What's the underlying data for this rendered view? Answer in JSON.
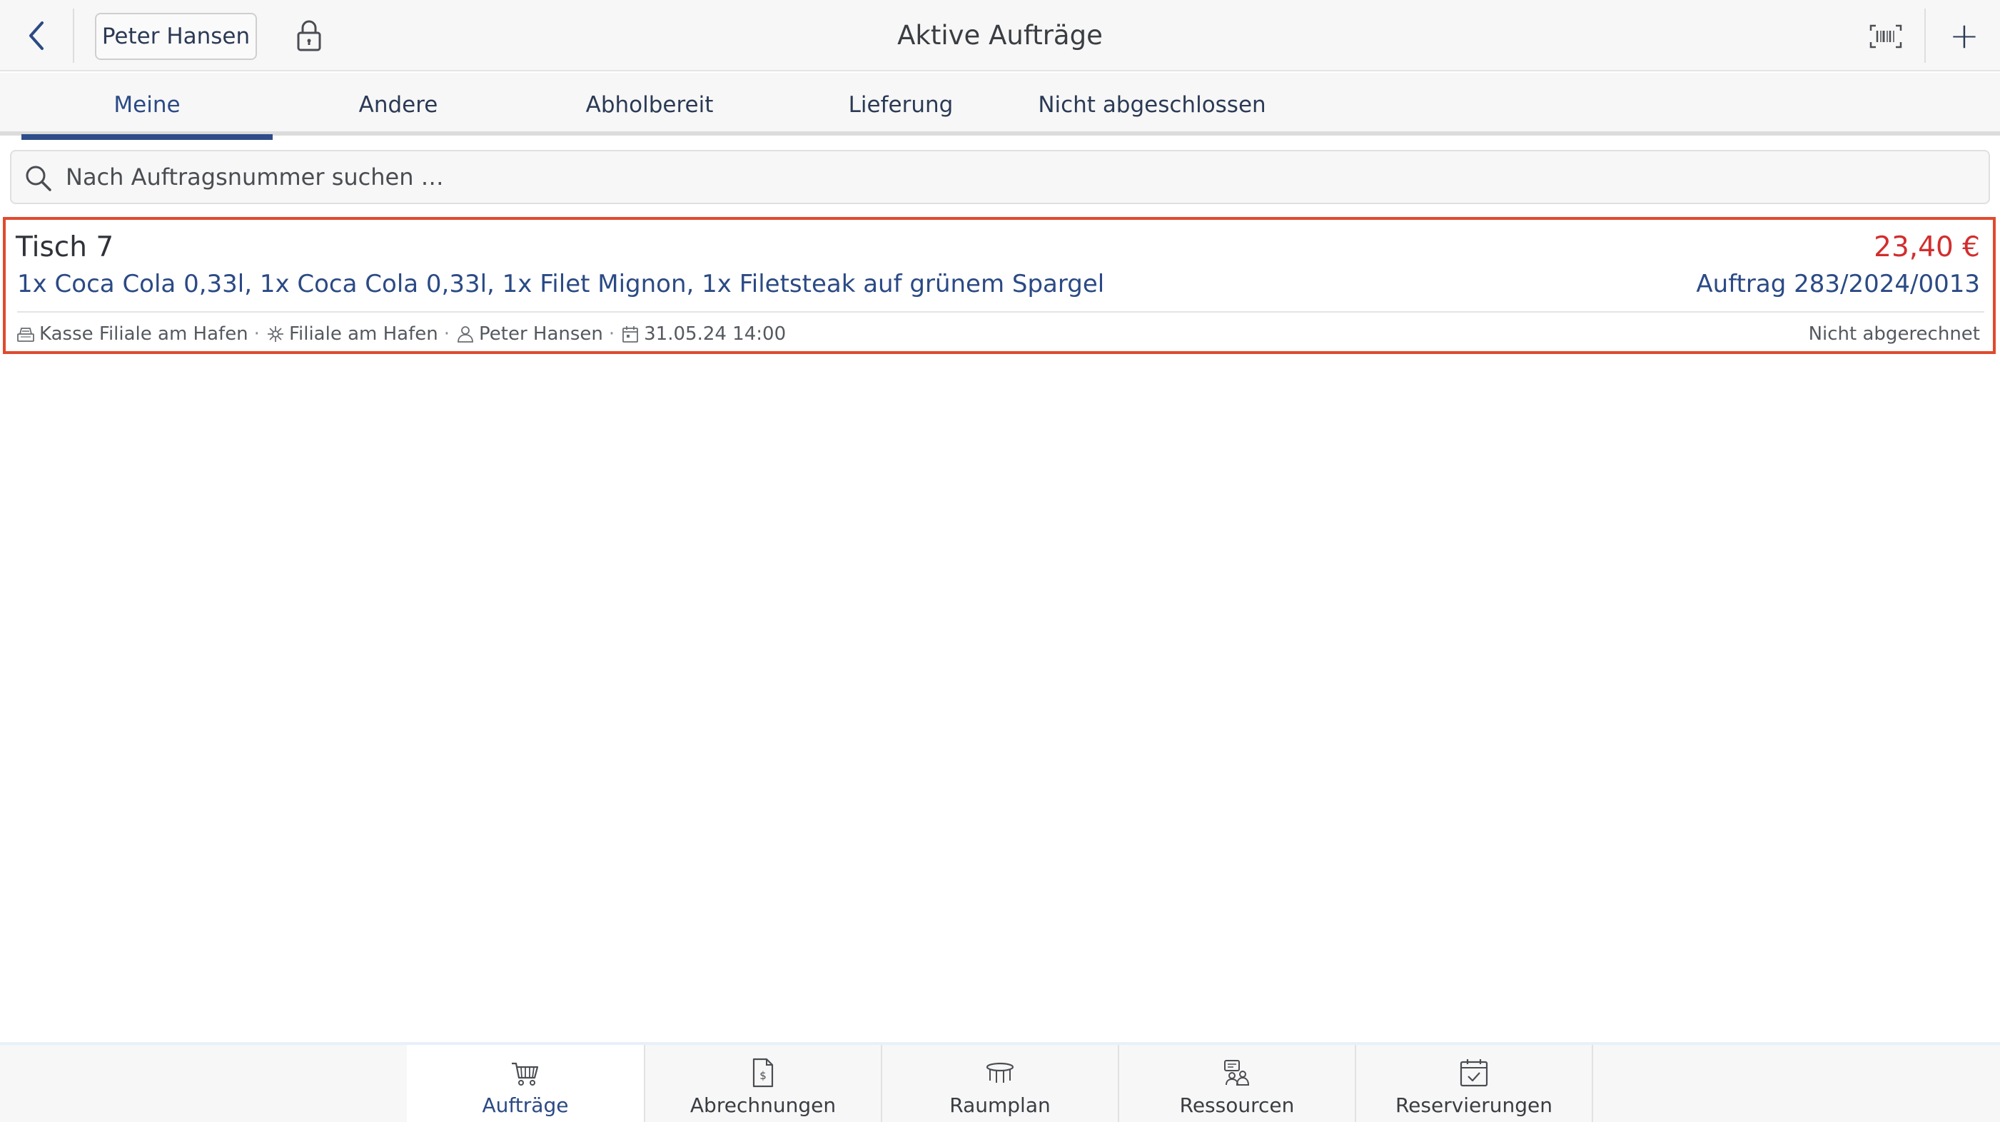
{
  "header": {
    "user_label": "Peter Hansen",
    "title": "Aktive Aufträge",
    "add_label": "+"
  },
  "tabs": [
    {
      "label": "Meine",
      "active": true
    },
    {
      "label": "Andere",
      "active": false
    },
    {
      "label": "Abholbereit",
      "active": false
    },
    {
      "label": "Lieferung",
      "active": false
    },
    {
      "label": "Nicht abgeschlossen",
      "active": false
    }
  ],
  "search": {
    "placeholder": "Nach Auftragsnummer suchen …",
    "value": ""
  },
  "orders": [
    {
      "table": "Tisch 7",
      "price": "23,40 €",
      "items": "1x Coca Cola 0,33l, 1x Coca Cola 0,33l, 1x Filet Mignon, 1x Filetsteak auf grünem Spargel",
      "number": "Auftrag 283/2024/0013",
      "register": "Kasse Filiale am Hafen",
      "branch": "Filiale am Hafen",
      "waiter": "Peter Hansen",
      "datetime": "31.05.24 14:00",
      "status": "Nicht abgerechnet"
    }
  ],
  "bottom_nav": [
    {
      "label": "Aufträge",
      "icon": "basket-icon",
      "active": true
    },
    {
      "label": "Abrechnungen",
      "icon": "invoice-icon",
      "active": false
    },
    {
      "label": "Raumplan",
      "icon": "table-icon",
      "active": false
    },
    {
      "label": "Ressourcen",
      "icon": "resources-icon",
      "active": false
    },
    {
      "label": "Reservierungen",
      "icon": "calendar-check-icon",
      "active": false
    }
  ],
  "colors": {
    "accent": "#2e4d8a",
    "price": "#d22e2e",
    "highlight_border": "#e04a2e"
  }
}
